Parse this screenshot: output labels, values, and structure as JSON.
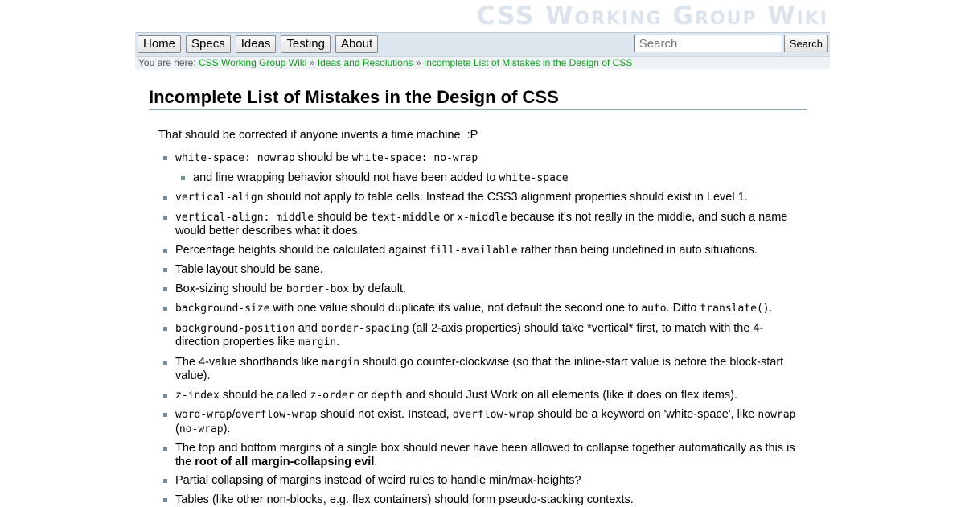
{
  "site": {
    "title": "CSS Working Group Wiki"
  },
  "nav": {
    "items": [
      "Home",
      "Specs",
      "Ideas",
      "Testing",
      "About"
    ],
    "search_placeholder": "Search",
    "search_button": "Search"
  },
  "breadcrumb": {
    "prefix": "You are here: ",
    "items": [
      "CSS Working Group Wiki",
      "Ideas and Resolutions",
      "Incomplete List of Mistakes in the Design of CSS"
    ],
    "separator": " » "
  },
  "page": {
    "title": "Incomplete List of Mistakes in the Design of CSS",
    "intro": "That should be corrected if anyone invents a time machine. :P",
    "items": [
      [
        {
          "c": "white-space: nowrap"
        },
        {
          "t": " should be "
        },
        {
          "c": "white-space: no-wrap"
        }
      ],
      [
        {
          "c": "vertical-align"
        },
        {
          "t": " should not apply to table cells. Instead the CSS3 alignment properties should exist in Level 1."
        }
      ],
      [
        {
          "c": "vertical-align: middle"
        },
        {
          "t": " should be "
        },
        {
          "c": "text-middle"
        },
        {
          "t": " or "
        },
        {
          "c": "x-middle"
        },
        {
          "t": " because it's not really in the middle, and such a name would better describes what it does."
        }
      ],
      [
        {
          "t": "Percentage heights should be calculated against "
        },
        {
          "c": "fill-available"
        },
        {
          "t": " rather than being undefined in auto situations."
        }
      ],
      [
        {
          "t": "Table layout should be sane."
        }
      ],
      [
        {
          "t": "Box-sizing should be "
        },
        {
          "c": "border-box"
        },
        {
          "t": " by default."
        }
      ],
      [
        {
          "c": "background-size"
        },
        {
          "t": " with one value should duplicate its value, not default the second one to "
        },
        {
          "c": "auto"
        },
        {
          "t": ". Ditto "
        },
        {
          "c": "translate()"
        },
        {
          "t": "."
        }
      ],
      [
        {
          "c": "background-position"
        },
        {
          "t": " and "
        },
        {
          "c": "border-spacing"
        },
        {
          "t": " (all 2-axis properties) should take *vertical* first, to match with the 4-direction properties like "
        },
        {
          "c": "margin"
        },
        {
          "t": "."
        }
      ],
      [
        {
          "t": "The 4-value shorthands like "
        },
        {
          "c": "margin"
        },
        {
          "t": " should go counter-clockwise (so that the inline-start value is before the block-start value)."
        }
      ],
      [
        {
          "c": "z-index"
        },
        {
          "t": " should be called "
        },
        {
          "c": "z-order"
        },
        {
          "t": " or "
        },
        {
          "c": "depth"
        },
        {
          "t": " and should Just Work on all elements (like it does on flex items)."
        }
      ],
      [
        {
          "c": "word-wrap"
        },
        {
          "t": "/"
        },
        {
          "c": "overflow-wrap"
        },
        {
          "t": " should not exist. Instead, "
        },
        {
          "c": "overflow-wrap"
        },
        {
          "t": " should be a keyword on 'white-space', like "
        },
        {
          "c": "nowrap"
        },
        {
          "t": " ("
        },
        {
          "c": "no-wrap"
        },
        {
          "t": ")."
        }
      ],
      [
        {
          "t": "The top and bottom margins of a single box should never have been allowed to collapse together automatically as this is the "
        },
        {
          "b": "root of all margin-collapsing evil"
        },
        {
          "t": "."
        }
      ],
      [
        {
          "t": "Partial collapsing of margins instead of weird rules to handle min/max-heights?"
        }
      ],
      [
        {
          "t": "Tables (like other non-blocks, e.g. flex containers) should form pseudo-stacking contexts."
        }
      ]
    ],
    "sub_items": {
      "0": [
        [
          {
            "t": "and line wrapping behavior should not have been added to "
          },
          {
            "c": "white-space"
          }
        ]
      ]
    }
  }
}
